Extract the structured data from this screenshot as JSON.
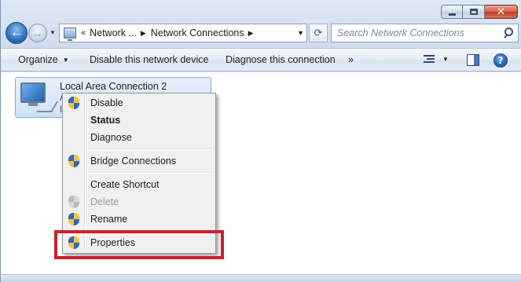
{
  "window": {
    "caption_buttons": {
      "minimize": "minimize",
      "maximize": "maximize",
      "close": "close"
    }
  },
  "nav": {
    "address_prefix": "«",
    "breadcrumbs": [
      "Network ...",
      "Network Connections"
    ],
    "search_placeholder": "Search Network Connections"
  },
  "toolbar": {
    "organize": "Organize",
    "disable": "Disable this network device",
    "diagnose": "Diagnose this connection",
    "more": "»"
  },
  "connection": {
    "name": "Local Area Connection 2",
    "status_partial": "A",
    "device_partial": "I"
  },
  "context_menu": {
    "items": [
      {
        "label": "Disable",
        "icon": "uac-shield-icon"
      },
      {
        "label": "Status",
        "icon": ""
      },
      {
        "label": "Diagnose",
        "icon": ""
      },
      {
        "label": "Bridge Connections",
        "icon": "uac-shield-icon"
      },
      {
        "label": "Create Shortcut",
        "icon": ""
      },
      {
        "label": "Delete",
        "icon": "uac-shield-icon-disabled"
      },
      {
        "label": "Rename",
        "icon": "uac-shield-icon"
      },
      {
        "label": "Properties",
        "icon": "uac-shield-icon"
      }
    ]
  },
  "annotation": {
    "highlight_color": "#d0202e",
    "highlighted_item": "Properties"
  }
}
